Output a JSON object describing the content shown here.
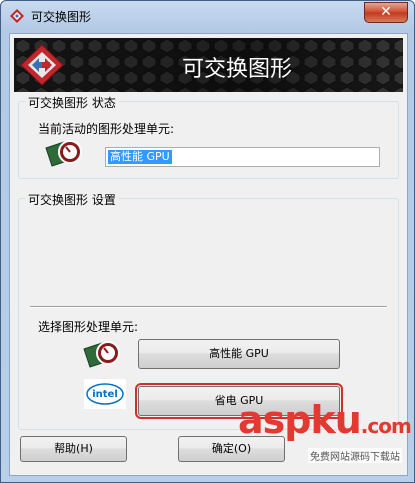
{
  "window": {
    "title": "可交换图形",
    "close_glyph": "✕"
  },
  "banner": {
    "title": "可交换图形"
  },
  "status_group": {
    "label": "可交换图形 状态",
    "active_label": "当前活动的图形处理单元:",
    "active_value": "高性能 GPU"
  },
  "settings_group": {
    "label": "可交换图形 设置",
    "select_label": "选择图形处理单元:",
    "high_perf_button": "高性能 GPU",
    "power_save_button": "省电 GPU",
    "intel_logo_text": "intel"
  },
  "footer": {
    "help_button": "帮助(H)",
    "ok_button": "确定(O)"
  },
  "watermark": {
    "main": "aspku",
    "tld": ".com",
    "sub": "免费网站源码下载站"
  },
  "colors": {
    "highlight": "#d0302b",
    "watermark": "#e23a31",
    "selection": "#3399ff"
  }
}
